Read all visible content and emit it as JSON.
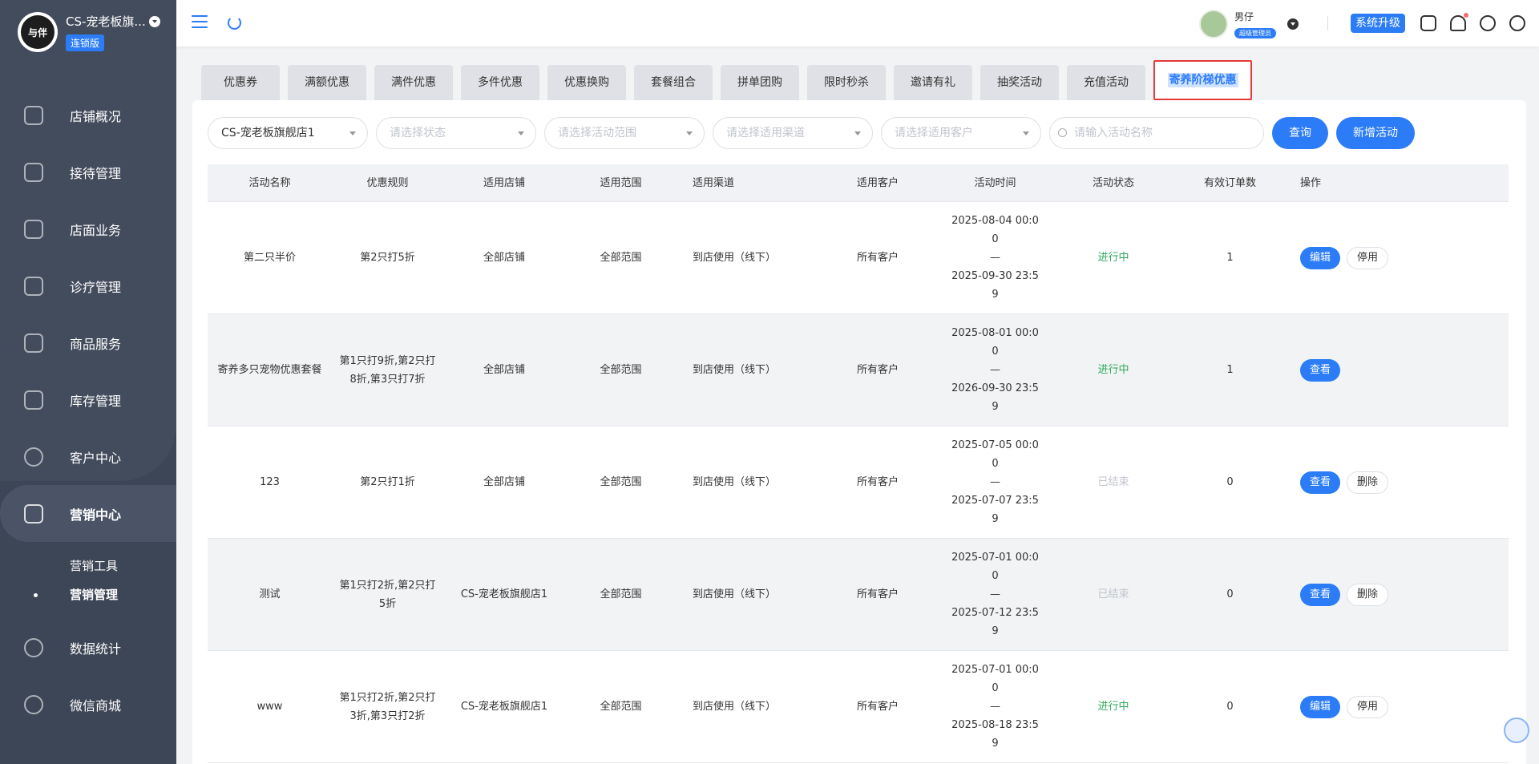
{
  "sidebar": {
    "logo_text": "与伴",
    "store_name": "CS-宠老板旗...",
    "edition": "连锁版",
    "menu": [
      {
        "label": "店铺概况",
        "icon": "monitor-icon"
      },
      {
        "label": "接待管理",
        "icon": "edit-icon"
      },
      {
        "label": "店面业务",
        "icon": "home-icon"
      },
      {
        "label": "诊疗管理",
        "icon": "medical-kit-icon"
      },
      {
        "label": "商品服务",
        "icon": "bag-icon"
      },
      {
        "label": "库存管理",
        "icon": "box-icon"
      },
      {
        "label": "客户中心",
        "icon": "user-icon"
      },
      {
        "label": "营销中心",
        "icon": "chart-icon"
      }
    ],
    "sub_menu": [
      "营销工具",
      "营销管理"
    ],
    "menu_bottom": [
      {
        "label": "数据统计",
        "icon": "stats-icon"
      },
      {
        "label": "微信商城",
        "icon": "chat-icon"
      }
    ]
  },
  "topbar": {
    "user_name": "男仔",
    "user_role": "超级管理员",
    "upgrade": "系统升级"
  },
  "tabs": [
    "优惠券",
    "满额优惠",
    "满件优惠",
    "多件优惠",
    "优惠换购",
    "套餐组合",
    "拼单团购",
    "限时秒杀",
    "邀请有礼",
    "抽奖活动",
    "充值活动",
    "寄养阶梯优惠"
  ],
  "filters": {
    "store": "CS-宠老板旗舰店1",
    "status_placeholder": "请选择状态",
    "scope_placeholder": "请选择活动范围",
    "channel_placeholder": "请选择适用渠道",
    "customer_placeholder": "请选择适用客户",
    "search_placeholder": "请输入活动名称",
    "query": "查询",
    "add": "新增活动"
  },
  "table": {
    "headers": [
      "活动名称",
      "优惠规则",
      "适用店铺",
      "适用范围",
      "适用渠道",
      "适用客户",
      "活动时间",
      "活动状态",
      "有效订单数",
      "操作"
    ],
    "rows": [
      {
        "name": "第二只半价",
        "rule": "第2只打5折",
        "store": "全部店铺",
        "scope": "全部范围",
        "channel": "到店使用（线下）",
        "customer": "所有客户",
        "time_l1": "2025-08-04 00:0",
        "time_l2": "0",
        "time_l3": "—",
        "time_l4": "2025-09-30 23:5",
        "time_l5": "9",
        "status": "进行中",
        "orders": "1",
        "action1": "编辑",
        "action2": "停用"
      },
      {
        "name": "寄养多只宠物优惠套餐",
        "rule": "第1只打9折,第2只打8折,第3只打7折",
        "store": "全部店铺",
        "scope": "全部范围",
        "channel": "到店使用（线下）",
        "customer": "所有客户",
        "time_l1": "2025-08-01 00:0",
        "time_l2": "0",
        "time_l3": "—",
        "time_l4": "2026-09-30 23:5",
        "time_l5": "9",
        "status": "进行中",
        "orders": "1",
        "action1": "查看",
        "action2": ""
      },
      {
        "name": "123",
        "rule": "第2只打1折",
        "store": "全部店铺",
        "scope": "全部范围",
        "channel": "到店使用（线下）",
        "customer": "所有客户",
        "time_l1": "2025-07-05 00:0",
        "time_l2": "0",
        "time_l3": "—",
        "time_l4": "2025-07-07 23:5",
        "time_l5": "9",
        "status": "已结束",
        "orders": "0",
        "action1": "查看",
        "action2": "删除"
      },
      {
        "name": "测试",
        "rule": "第1只打2折,第2只打5折",
        "store": "CS-宠老板旗舰店1",
        "scope": "全部范围",
        "channel": "到店使用（线下）",
        "customer": "所有客户",
        "time_l1": "2025-07-01 00:0",
        "time_l2": "0",
        "time_l3": "—",
        "time_l4": "2025-07-12 23:5",
        "time_l5": "9",
        "status": "已结束",
        "orders": "0",
        "action1": "查看",
        "action2": "删除"
      },
      {
        "name": "www",
        "rule": "第1只打2折,第2只打3折,第3只打2折",
        "store": "CS-宠老板旗舰店1",
        "scope": "全部范围",
        "channel": "到店使用（线下）",
        "customer": "所有客户",
        "time_l1": "2025-07-01 00:0",
        "time_l2": "0",
        "time_l3": "—",
        "time_l4": "2025-08-18 23:5",
        "time_l5": "9",
        "status": "进行中",
        "orders": "0",
        "action1": "编辑",
        "action2": "停用"
      }
    ]
  },
  "colors": {
    "primary": "#2b7cf6",
    "active_status": "#2eaa5c",
    "ended_status": "#c0c4cc",
    "sidebar": "#3d4656"
  }
}
